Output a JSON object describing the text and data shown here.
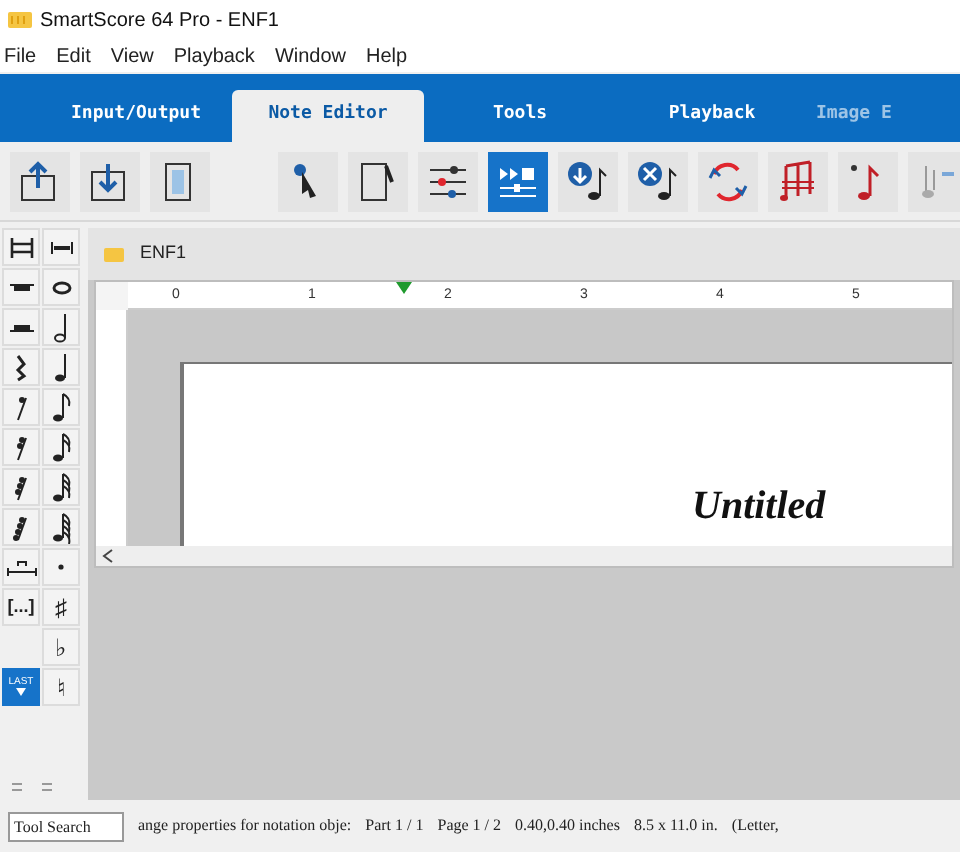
{
  "window": {
    "title": "SmartScore 64 Pro - ENF1"
  },
  "menu": [
    "File",
    "Edit",
    "View",
    "Playback",
    "Window",
    "Help"
  ],
  "tabs": [
    {
      "label": "Input/Output",
      "selected": false
    },
    {
      "label": "Note Editor",
      "selected": true
    },
    {
      "label": "Tools",
      "selected": false
    },
    {
      "label": "Playback",
      "selected": false
    },
    {
      "label": "Image E",
      "selected": false
    }
  ],
  "toolbar": {
    "buttons": [
      {
        "selected": false
      },
      {
        "selected": false
      },
      {
        "selected": false
      },
      {
        "selected": false
      },
      {
        "selected": false
      },
      {
        "selected": false
      },
      {
        "selected": true
      },
      {
        "selected": false
      },
      {
        "selected": false
      },
      {
        "selected": false
      },
      {
        "selected": false
      },
      {
        "selected": false
      },
      {
        "selected": false
      }
    ]
  },
  "palette": {
    "texts": [
      "[...]",
      "♯",
      "♭",
      "♮"
    ],
    "last_button": "LAST"
  },
  "document": {
    "tab": "ENF1",
    "ruler_numbers": [
      "0",
      "1",
      "2",
      "3",
      "4",
      "5"
    ],
    "title": "Untitled"
  },
  "status_bar": {
    "search": {
      "placeholder": "Tool Search"
    },
    "segments": [
      "ange properties for notation obje:",
      "Part 1 / 1",
      "Page 1 / 2",
      "0.40,0.40 inches",
      "8.5 x 11.0 in.",
      "(Letter,"
    ]
  }
}
